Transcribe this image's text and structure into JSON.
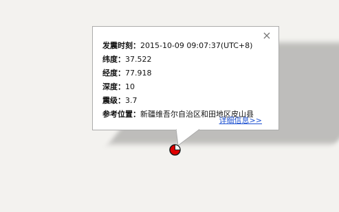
{
  "popup": {
    "close_symbol": "×",
    "rows": [
      {
        "label": "发震时刻：",
        "value": "2015-10-09 09:07:37(UTC+8)"
      },
      {
        "label": "纬度：",
        "value": "37.522"
      },
      {
        "label": "经度：",
        "value": "77.918"
      },
      {
        "label": "深度：",
        "value": "10"
      },
      {
        "label": "震级：",
        "value": "3.7"
      },
      {
        "label": "参考位置：",
        "value": "新疆维吾尔自治区和田地区皮山县"
      }
    ],
    "detail_link": "详细信息>>"
  },
  "marker": {
    "icon": "earthquake-marker-icon",
    "color": "#e00000"
  }
}
